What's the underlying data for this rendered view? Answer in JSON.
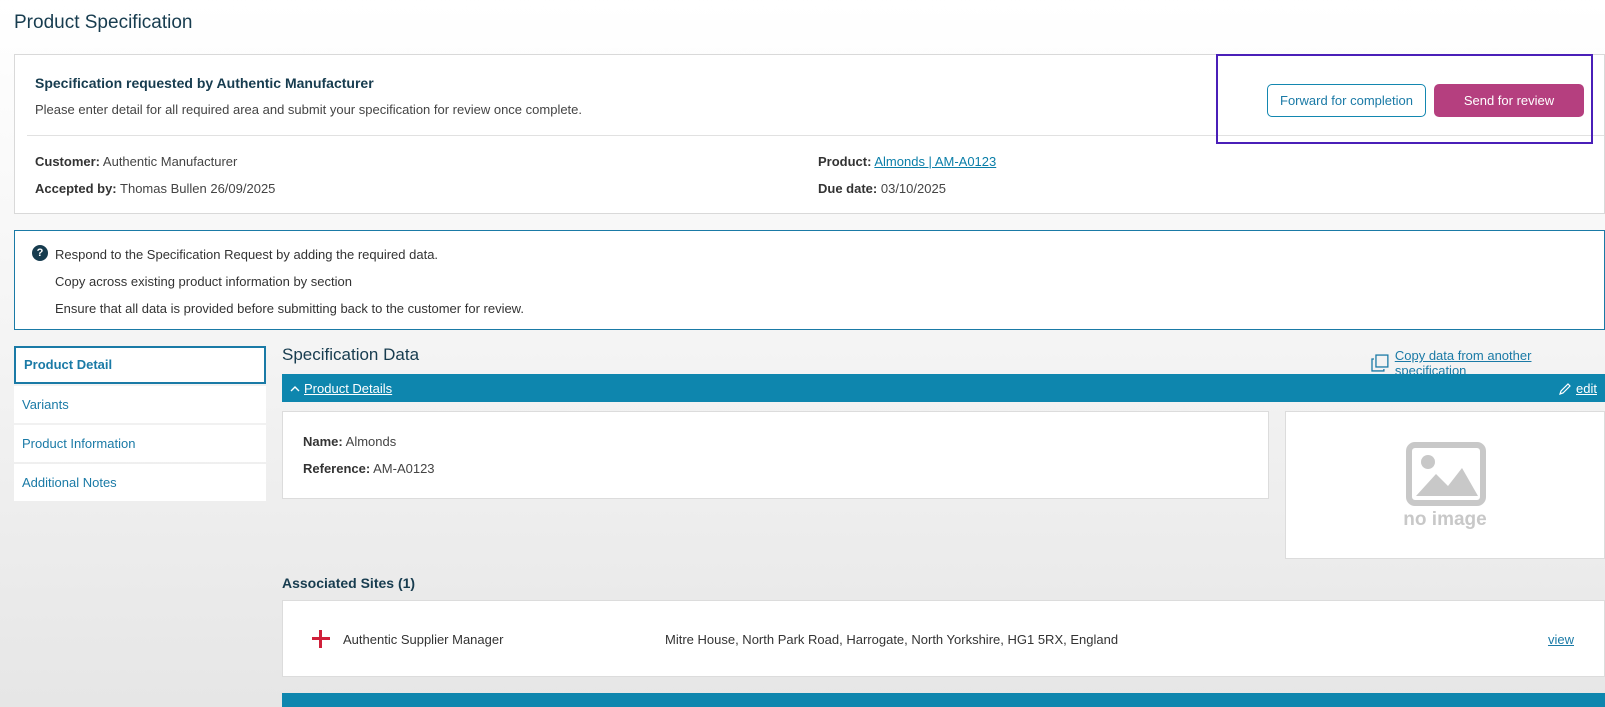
{
  "page": {
    "title": "Product Specification"
  },
  "request": {
    "heading": "Specification requested by Authentic Manufacturer",
    "subtext": "Please enter detail for all required area and submit your specification for review once complete.",
    "customer_label": "Customer:",
    "customer_value": "Authentic Manufacturer",
    "accepted_label": "Accepted by:",
    "accepted_value": "Thomas Bullen 26/09/2025",
    "product_label": "Product:",
    "product_value": "Almonds | AM-A0123",
    "due_label": "Due date:",
    "due_value": "03/10/2025"
  },
  "actions": {
    "forward_label": "Forward for completion",
    "send_label": "Send for review"
  },
  "info": {
    "icon": "question-icon",
    "glyph": "?",
    "lines": [
      "Respond to the Specification Request by adding the required data.",
      "Copy across existing product information by section",
      "Ensure that all data is provided before submitting back to the customer for review."
    ]
  },
  "sidebar": {
    "items": [
      {
        "label": "Product Detail",
        "active": true
      },
      {
        "label": "Variants",
        "active": false
      },
      {
        "label": "Product Information",
        "active": false
      },
      {
        "label": "Additional Notes",
        "active": false
      }
    ]
  },
  "spec": {
    "title": "Specification Data",
    "copy_link": "Copy data from another specification"
  },
  "product_details": {
    "bar_title": "Product Details",
    "edit_label": "edit",
    "name_label": "Name:",
    "name_value": "Almonds",
    "reference_label": "Reference:",
    "reference_value": "AM-A0123",
    "no_image_text": "no image"
  },
  "sites": {
    "heading": "Associated Sites (1)",
    "rows": [
      {
        "name": "Authentic Supplier Manager",
        "address": "Mitre House, North Park Road, Harrogate, North Yorkshire, HG1 5RX, England",
        "view_label": "view"
      }
    ]
  },
  "colors": {
    "accent": "#0e86ae",
    "primary_button": "#b53f7f",
    "highlight": "#4a1fb8",
    "heading": "#173c4f"
  }
}
